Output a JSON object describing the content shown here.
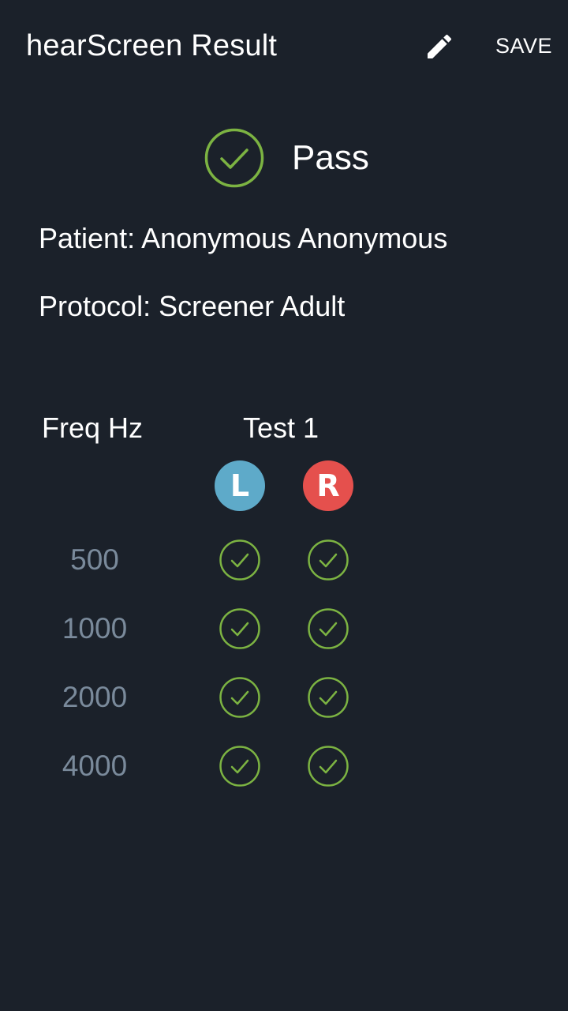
{
  "toolbar": {
    "title": "hearScreen Result",
    "edit_icon": "pencil-icon",
    "save_label": "SAVE"
  },
  "result": {
    "status": "Pass",
    "icon": "check-circle-icon",
    "color": "#7cb342"
  },
  "patient_line": "Patient: Anonymous Anonymous",
  "protocol_line": "Protocol: Screener Adult",
  "table": {
    "freq_header": "Freq Hz",
    "test_header": "Test 1",
    "ears": [
      {
        "label": "L",
        "color": "#5eaac9"
      },
      {
        "label": "R",
        "color": "#e5504d"
      }
    ],
    "rows": [
      {
        "freq": "500",
        "left": "pass",
        "right": "pass"
      },
      {
        "freq": "1000",
        "left": "pass",
        "right": "pass"
      },
      {
        "freq": "2000",
        "left": "pass",
        "right": "pass"
      },
      {
        "freq": "4000",
        "left": "pass",
        "right": "pass"
      }
    ]
  },
  "colors": {
    "background": "#1b212a",
    "pass_green": "#7cb342",
    "freq_text": "#7a8a9b"
  }
}
